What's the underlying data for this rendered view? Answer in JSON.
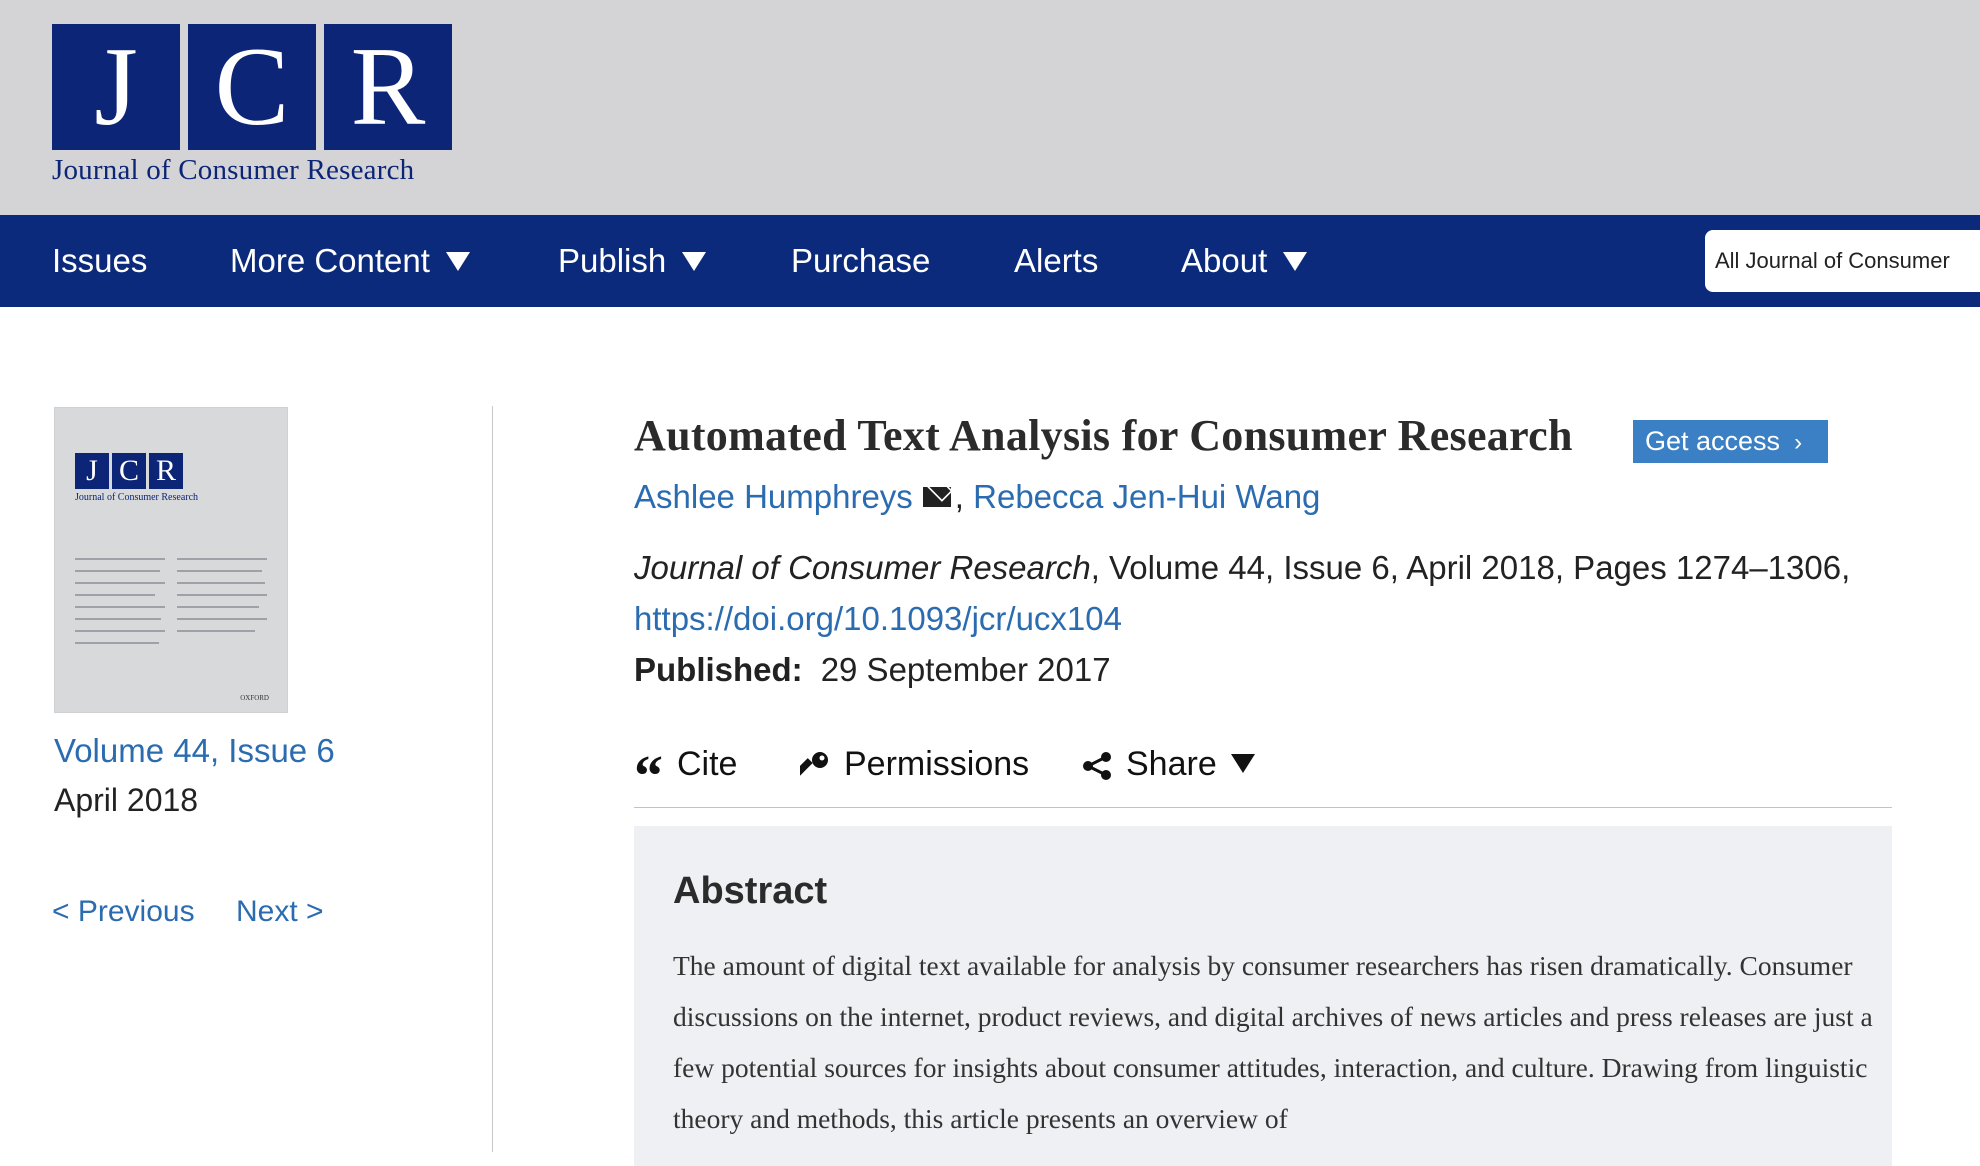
{
  "header": {
    "logo": {
      "letters": [
        "J",
        "C",
        "R"
      ],
      "subtitle": "Journal of Consumer Research"
    }
  },
  "nav": {
    "items": [
      {
        "label": "Issues",
        "has_dropdown": false
      },
      {
        "label": "More Content",
        "has_dropdown": true
      },
      {
        "label": "Publish",
        "has_dropdown": true
      },
      {
        "label": "Purchase",
        "has_dropdown": false
      },
      {
        "label": "Alerts",
        "has_dropdown": false
      },
      {
        "label": "About",
        "has_dropdown": true
      }
    ],
    "search_value": "All Journal of Consumer"
  },
  "sidebar": {
    "cover": {
      "letters": [
        "J",
        "C",
        "R"
      ],
      "subtitle": "Journal of Consumer Research",
      "publisher": "OXFORD"
    },
    "volume_link": "Volume 44, Issue 6",
    "issue_date": "April 2018",
    "prev_label": "< Previous",
    "next_label": "Next >"
  },
  "article": {
    "title": "Automated Text Analysis for Consumer Research",
    "get_access_label": "Get access",
    "authors": [
      "Ashlee Humphreys",
      "Rebecca Jen-Hui Wang"
    ],
    "author_separator": ",",
    "journal_name": "Journal of Consumer Research",
    "citation_rest": ", Volume 44, Issue 6, April 2018, Pages 1274–1306,",
    "doi": "https://doi.org/10.1093/jcr/ucx104",
    "published_label": "Published:",
    "published_date": "29 September 2017"
  },
  "tools": {
    "cite_label": "Cite",
    "permissions_label": "Permissions",
    "share_label": "Share"
  },
  "abstract": {
    "heading": "Abstract",
    "text": "The amount of digital text available for analysis by consumer researchers has risen dramatically. Consumer discussions on the internet, product reviews, and digital archives of news articles and press releases are just a few potential sources for insights about consumer attitudes, interaction, and culture. Drawing from linguistic theory and methods, this article presents an overview of"
  },
  "colors": {
    "brand_navy": "#0c2577",
    "nav_bg": "#0c2a7c",
    "header_bg": "#d4d4d6",
    "link_blue": "#2b6cb0",
    "button_blue": "#3b7fc4",
    "abstract_bg": "#eff0f3"
  }
}
